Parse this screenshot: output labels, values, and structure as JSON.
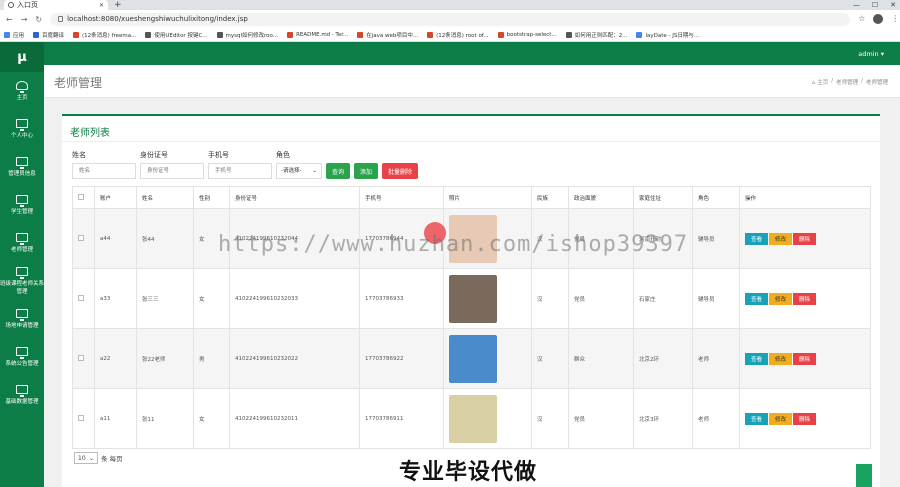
{
  "browser": {
    "tab_title": "入口页",
    "url": "localhost:8080/xueshengshiwuchulixitong/index.jsp",
    "bookmarks": [
      {
        "label": "应用",
        "color": "#4285f4"
      },
      {
        "label": "百度翻译",
        "color": "#2a62d8"
      },
      {
        "label": "(12条消息) freema...",
        "color": "#d9452b"
      },
      {
        "label": "使用UEditor 按键C...",
        "color": "#555555"
      },
      {
        "label": "mysql如何修改roo...",
        "color": "#555555"
      },
      {
        "label": "README.md · Ter...",
        "color": "#d9452b"
      },
      {
        "label": "在java web项目中...",
        "color": "#d9452b"
      },
      {
        "label": "(12条消息) root of...",
        "color": "#d9452b"
      },
      {
        "label": "bootstrap-select...",
        "color": "#d9452b"
      },
      {
        "label": "如何用正则匹配：2...",
        "color": "#555555"
      },
      {
        "label": "layDate - JS日期与...",
        "color": "#4285f4"
      }
    ]
  },
  "app": {
    "logo": "μ",
    "admin_label": "admin ▾",
    "page_title": "老师管理",
    "breadcrumb": [
      "⌂ 主页",
      "/",
      "老师管理",
      "/",
      "老师管理"
    ],
    "sidebar": [
      {
        "label": "主页",
        "icon": "dashboard-icon"
      },
      {
        "label": "个人中心",
        "icon": "monitor-icon"
      },
      {
        "label": "管理员信息",
        "icon": "monitor-icon"
      },
      {
        "label": "学生管理",
        "icon": "monitor-icon"
      },
      {
        "label": "老师管理",
        "icon": "monitor-icon"
      },
      {
        "label": "班级课程老师关系管理",
        "icon": "monitor-icon"
      },
      {
        "label": "场地申请管理",
        "icon": "monitor-icon"
      },
      {
        "label": "系统公告管理",
        "icon": "monitor-icon"
      },
      {
        "label": "基础数据管理",
        "icon": "monitor-icon"
      }
    ]
  },
  "card": {
    "title": "老师列表",
    "filters": {
      "name_label": "姓名",
      "name_placeholder": "姓名",
      "id_label": "身份证号",
      "id_placeholder": "身份证号",
      "phone_label": "手机号",
      "phone_placeholder": "手机号",
      "role_label": "角色",
      "role_value": "-请选择-"
    },
    "buttons": {
      "search": "查询",
      "add": "添加",
      "batch_delete": "批量删除"
    },
    "columns": [
      "账户",
      "姓名",
      "性别",
      "身份证号",
      "手机号",
      "照片",
      "民族",
      "政治面貌",
      "家庭住址",
      "角色",
      "操作"
    ],
    "rows": [
      {
        "account": "a44",
        "name": "张44",
        "gender": "女",
        "id_no": "410224199610232044",
        "phone": "17703786944",
        "ethnicity": "汉",
        "political": "党员",
        "address": "河南开封",
        "role": "辅导员",
        "photo_color": "#e8c9b5"
      },
      {
        "account": "a33",
        "name": "张三三",
        "gender": "女",
        "id_no": "410224199610232033",
        "phone": "17703786933",
        "ethnicity": "汉",
        "political": "党员",
        "address": "石家庄",
        "role": "辅导员",
        "photo_color": "#7a6a5c"
      },
      {
        "account": "a22",
        "name": "张22老师",
        "gender": "男",
        "id_no": "410224199610232022",
        "phone": "17703786922",
        "ethnicity": "汉",
        "political": "群众",
        "address": "北京2环",
        "role": "老师",
        "photo_color": "#4a8cc9"
      },
      {
        "account": "a11",
        "name": "张11",
        "gender": "女",
        "id_no": "410224199610232011",
        "phone": "17703786911",
        "ethnicity": "汉",
        "political": "党员",
        "address": "北京3环",
        "role": "老师",
        "photo_color": "#d8cfa4"
      }
    ],
    "ops": {
      "view": "查看",
      "edit": "修改",
      "del": "删除"
    }
  },
  "pager": {
    "size": "10",
    "suffix": "条 每页"
  },
  "watermark": {
    "url": "https://www.huzhan.com/ishop39397",
    "slogan": "专业毕设代做"
  }
}
